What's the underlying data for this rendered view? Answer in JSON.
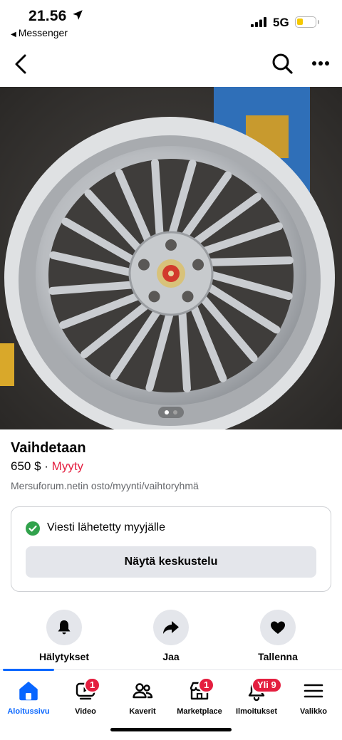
{
  "status_bar": {
    "time": "21.56",
    "back_app": "Messenger",
    "network": "5G",
    "battery_level": 0.35
  },
  "listing": {
    "title": "Vaihdetaan",
    "price": "650 $",
    "separator": " · ",
    "status": "Myyty",
    "group": "Mersuforum.netin osto/myynti/vaihtoryhmä",
    "photo_count": 2,
    "photo_index": 1
  },
  "message_card": {
    "sent_text": "Viesti lähetetty myyjälle",
    "button_label": "Näytä keskustelu"
  },
  "actions": [
    {
      "label": "Hälytykset",
      "icon": "bell-icon"
    },
    {
      "label": "Jaa",
      "icon": "share-icon"
    },
    {
      "label": "Tallenna",
      "icon": "heart-icon"
    }
  ],
  "tabs": [
    {
      "label": "Aloitussivu",
      "icon": "home-icon",
      "badge": ""
    },
    {
      "label": "Video",
      "icon": "video-icon",
      "badge": "1"
    },
    {
      "label": "Kaverit",
      "icon": "friends-icon",
      "badge": ""
    },
    {
      "label": "Marketplace",
      "icon": "marketplace-icon",
      "badge": "1"
    },
    {
      "label": "Ilmoitukset",
      "icon": "notifications-icon",
      "badge": "Yli 9"
    },
    {
      "label": "Valikko",
      "icon": "menu-icon",
      "badge": ""
    }
  ],
  "colors": {
    "accent": "#0866ff",
    "sold": "#e41e3f",
    "success": "#31a24c",
    "button_bg": "#e4e6eb"
  }
}
